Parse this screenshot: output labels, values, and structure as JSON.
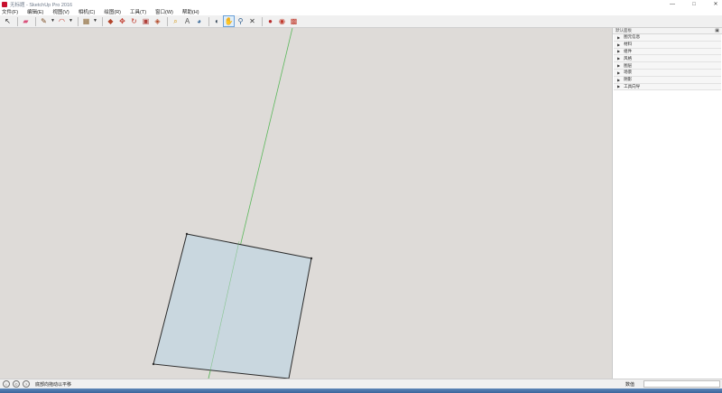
{
  "window": {
    "title": "无标题 - SketchUp Pro 2016",
    "minimize_glyph": "—",
    "maximize_glyph": "□",
    "close_glyph": "✕"
  },
  "menu": [
    "文件(F)",
    "编辑(E)",
    "视图(V)",
    "相机(C)",
    "绘图(R)",
    "工具(T)",
    "窗口(W)",
    "帮助(H)"
  ],
  "toolbar": {
    "tools": [
      {
        "name": "select-tool",
        "glyph": "↖",
        "color": "#222222"
      },
      {
        "name": "eraser-tool",
        "glyph": "▰",
        "color": "#d9507a"
      },
      {
        "name": "line-tool",
        "glyph": "✎",
        "color": "#7a4a1f"
      },
      {
        "name": "arc-tool",
        "glyph": "◠",
        "color": "#c0392b"
      },
      {
        "name": "shape-tool",
        "glyph": "▦",
        "color": "#8e6b3a"
      },
      {
        "name": "pushpull-tool",
        "glyph": "◆",
        "color": "#b2442b"
      },
      {
        "name": "move-tool",
        "glyph": "✥",
        "color": "#c0392b"
      },
      {
        "name": "rotate-tool",
        "glyph": "↻",
        "color": "#c0392b"
      },
      {
        "name": "scale-tool",
        "glyph": "▣",
        "color": "#b0403a"
      },
      {
        "name": "offset-tool",
        "glyph": "◈",
        "color": "#b24a2a"
      },
      {
        "name": "tape-measure-tool",
        "glyph": "⌕",
        "color": "#d49a1a"
      },
      {
        "name": "text-tool",
        "glyph": "A",
        "color": "#555555"
      },
      {
        "name": "paint-bucket-tool",
        "glyph": "◕",
        "color": "#3a6a9a"
      },
      {
        "name": "orbit-tool",
        "glyph": "◐",
        "color": "#2c3e50"
      },
      {
        "name": "pan-tool",
        "glyph": "✋",
        "color": "#d8a040"
      },
      {
        "name": "zoom-tool",
        "glyph": "⚲",
        "color": "#2f5f8f"
      },
      {
        "name": "zoom-extents-tool",
        "glyph": "✕",
        "color": "#3a3a3a"
      },
      {
        "name": "warehouse-tool",
        "glyph": "●",
        "color": "#b82e2e"
      },
      {
        "name": "share-model-tool",
        "glyph": "◉",
        "color": "#c0392b"
      },
      {
        "name": "extension-warehouse-tool",
        "glyph": "▩",
        "color": "#c0392b"
      }
    ]
  },
  "tray": {
    "title": "默认面板",
    "pin_glyph": "▣",
    "panels": [
      "图元信息",
      "材料",
      "组件",
      "风格",
      "图层",
      "场景",
      "阴影",
      "工具向导"
    ]
  },
  "status": {
    "hint": "底部向拖动以平移",
    "measure_label": "数值",
    "measure_value": ""
  },
  "colors": {
    "viewport_bg": "#dedbd8",
    "face_fill": "#c9d7df",
    "edge": "#2b2b2b",
    "green_axis": "#5bb85b"
  }
}
